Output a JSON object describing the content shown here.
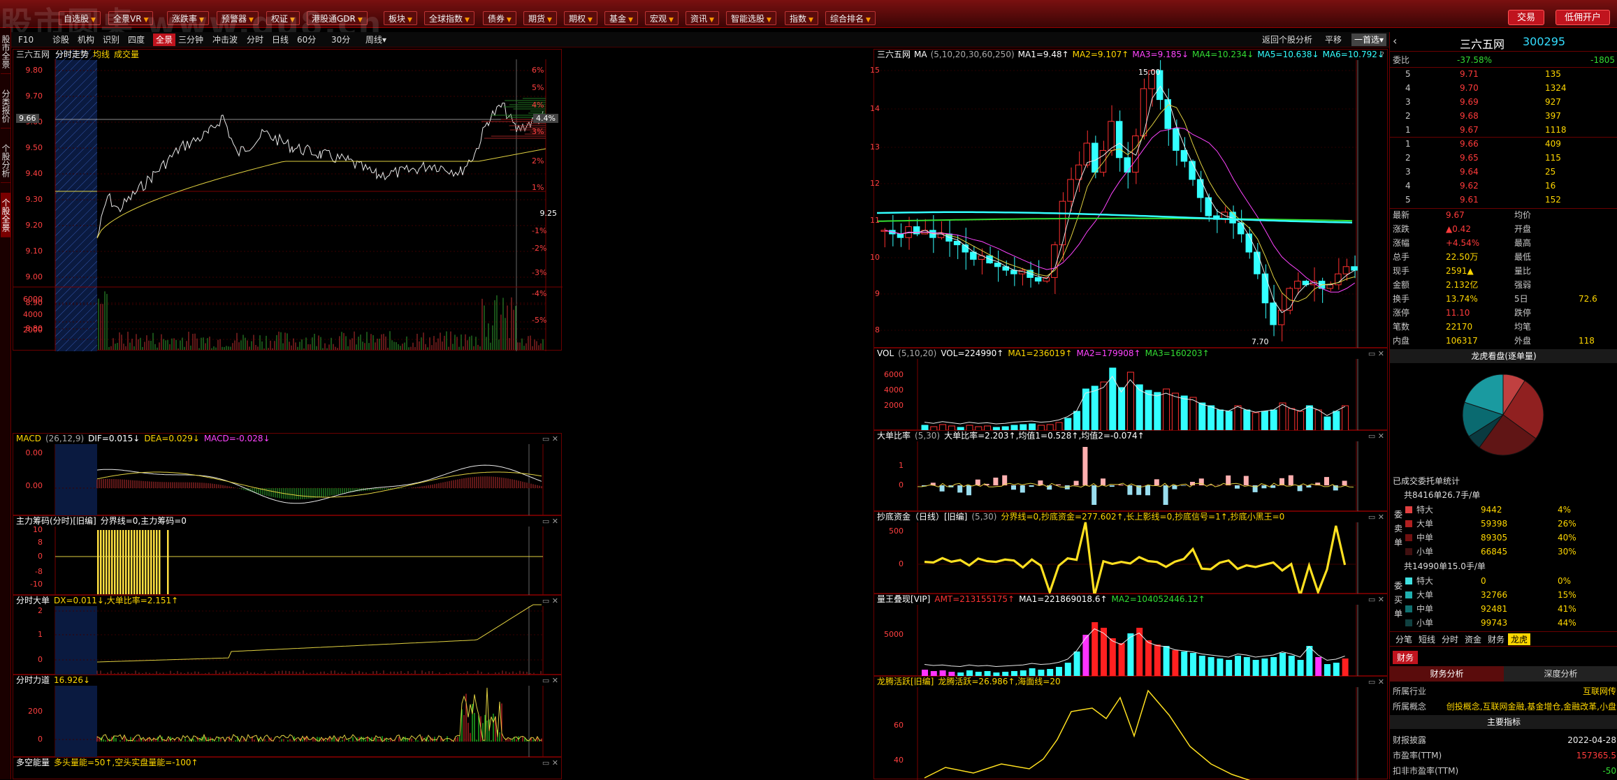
{
  "watermark": "股市圆桌 www.gu8.cn",
  "topbar": {
    "buttons": [
      "自选股",
      "全景VR",
      "涨跌率",
      "预警器",
      "权证",
      "港股通GDR",
      "板块",
      "全球指数",
      "债券",
      "期货",
      "期权",
      "基金",
      "宏观",
      "资讯",
      "智能选股",
      "指数",
      "综合排名"
    ],
    "trade": "交易",
    "open_account": "低佣开户"
  },
  "left_tabs": [
    "股市全景",
    "分类报价",
    "个股分析",
    "个股全景"
  ],
  "subbar": {
    "items": [
      "F10",
      "诊股",
      "机构",
      "识别",
      "四度",
      "全景",
      "三分钟",
      "冲击波",
      "分时",
      "日线",
      "60分",
      "30分",
      "周线▾"
    ],
    "active": "全景",
    "right_items": [
      "返回个股分析",
      "平移",
      "一首选▾"
    ]
  },
  "intraday": {
    "title": "三六五网",
    "tabs": [
      "分时走势",
      "均线",
      "成交量"
    ],
    "yleft": [
      "9.80",
      "9.70",
      "9.60",
      "9.50",
      "9.40",
      "9.30",
      "9.20",
      "9.10",
      "9.00",
      "8.90",
      "8.80"
    ],
    "yright": [
      "6%",
      "5%",
      "4%",
      "3%",
      "2%",
      "1%",
      "-1%",
      "-2%",
      "-3%",
      "-4%",
      "-5%"
    ],
    "price_tag": "9.66",
    "pct_tag": "4.4%",
    "mid_label": "9.25",
    "vol_axis": [
      "6000",
      "4000",
      "2000"
    ]
  },
  "macd": {
    "name": "MACD",
    "params": "(26,12,9)",
    "dif": "DIF=0.015↓",
    "dea": "DEA=0.029↓",
    "macd": "MACD=-0.028↓",
    "axis": [
      "0.00",
      "0.00"
    ]
  },
  "zljm": {
    "name": "主力筹码(分时)[旧编]",
    "text": "分界线=0,主力筹码=0",
    "axis": [
      "10",
      "8",
      "0",
      "-8",
      "-10"
    ]
  },
  "fsdd": {
    "name": "分时大单",
    "text": "DX=0.011↓,大单比率=2.151↑",
    "axis": [
      "2",
      "1",
      "0"
    ]
  },
  "fsld": {
    "name": "分时力道",
    "text": "16.926↓",
    "axis": [
      "200",
      "0"
    ]
  },
  "dknl": {
    "name": "多空能量",
    "text": "多头量能=50↑,空头实盘量能=-100↑"
  },
  "kline": {
    "title": "三六五网",
    "ma_label": "MA",
    "ma_params": "(5,10,20,30,60,250)",
    "ma1": "MA1=9.48↑",
    "ma2": "MA2=9.107↑",
    "ma3": "MA3=9.185↓",
    "ma4": "MA4=10.234↓",
    "ma5": "MA5=10.638↓",
    "ma6": "MA6=10.792↓",
    "yaxis": [
      "15",
      "14",
      "13",
      "12",
      "11",
      "10",
      "9",
      "8"
    ],
    "high_label": "15.00",
    "low_label": "7.70"
  },
  "vol": {
    "name": "VOL",
    "params": "(5,10,20)",
    "v": "VOL=224990↑",
    "ma1": "MA1=236019↑",
    "ma2": "MA2=179908↑",
    "ma3": "MA3=160203↑",
    "axis": [
      "6000",
      "4000",
      "2000"
    ]
  },
  "ddbl": {
    "name": "大单比率",
    "params": "(5,30)",
    "text": "大单比率=2.203↑,均值1=0.528↑,均值2=-0.074↑",
    "axis": [
      "1",
      "0"
    ]
  },
  "cdzj": {
    "name": "抄底资金（日线）[旧编]",
    "params": "(5,30)",
    "text": "分界线=0,抄底资金=277.602↑,长上影线=0,抄底信号=1↑,抄底小黑王=0",
    "axis": [
      "500",
      "0"
    ]
  },
  "lwjx": {
    "name": "量王叠现[VIP]",
    "amt": "AMT=213155175↑",
    "ma1": "MA1=221869018.6↑",
    "ma2": "MA2=104052446.12↑",
    "axis": [
      "5000"
    ]
  },
  "lthy": {
    "name": "龙腾活跃[旧编]",
    "text": "龙腾活跃=26.986↑,海面线=20",
    "axis": [
      "60",
      "40"
    ]
  },
  "quote": {
    "name": "三六五网",
    "code": "300295",
    "weibi_label": "委比",
    "weibi": "-37.58%",
    "weicha": "-1805",
    "sell": [
      [
        "5",
        "9.71",
        "135"
      ],
      [
        "4",
        "9.70",
        "1324"
      ],
      [
        "3",
        "9.69",
        "927"
      ],
      [
        "2",
        "9.68",
        "397"
      ],
      [
        "1",
        "9.67",
        "1118"
      ]
    ],
    "buy": [
      [
        "1",
        "9.66",
        "409"
      ],
      [
        "2",
        "9.65",
        "115"
      ],
      [
        "3",
        "9.64",
        "25"
      ],
      [
        "4",
        "9.62",
        "16"
      ],
      [
        "5",
        "9.61",
        "152"
      ]
    ],
    "stats": [
      [
        "最新",
        "9.67",
        "均价",
        ""
      ],
      [
        "涨跌",
        "▲0.42",
        "开盘",
        ""
      ],
      [
        "涨幅",
        "+4.54%",
        "最高",
        ""
      ],
      [
        "总手",
        "22.50万",
        "最低",
        ""
      ],
      [
        "现手",
        "2591▲",
        "量比",
        ""
      ],
      [
        "金额",
        "2.132亿",
        "强弱",
        ""
      ],
      [
        "换手",
        "13.74%",
        "5日",
        "72.6"
      ],
      [
        "涨停",
        "11.10",
        "跌停",
        ""
      ],
      [
        "笔数",
        "22170",
        "均笔",
        ""
      ],
      [
        "内盘",
        "106317",
        "外盘",
        "118"
      ]
    ],
    "lhk_title": "龙虎看盘(逐单量)",
    "pie": [
      {
        "v": 0.09,
        "c": "#c04040"
      },
      {
        "v": 0.26,
        "c": "#902020"
      },
      {
        "v": 0.25,
        "c": "#601515"
      },
      {
        "v": 0.06,
        "c": "#0a3a40"
      },
      {
        "v": 0.14,
        "c": "#0a6a70"
      },
      {
        "v": 0.2,
        "c": "#1a9aa0"
      }
    ],
    "commit_title": "已成交委托单统计",
    "sell_total": "共8416单26.7手/单",
    "sell_side": [
      "委",
      "卖",
      "单"
    ],
    "sell_rows": [
      [
        "特大",
        "9442",
        "4%"
      ],
      [
        "大单",
        "59398",
        "26%"
      ],
      [
        "中单",
        "89305",
        "40%"
      ],
      [
        "小单",
        "66845",
        "30%"
      ]
    ],
    "buy_total": "共14990单15.0手/单",
    "buy_side": [
      "委",
      "买",
      "单"
    ],
    "buy_rows": [
      [
        "特大",
        "0",
        "0%"
      ],
      [
        "大单",
        "32766",
        "15%"
      ],
      [
        "中单",
        "92481",
        "41%"
      ],
      [
        "小单",
        "99743",
        "44%"
      ]
    ],
    "tabs": [
      "分笔",
      "短线",
      "分时",
      "资金",
      "财务",
      "龙虎"
    ],
    "fin_tab": "财务",
    "fin_sub": [
      "财务分析",
      "深度分析"
    ],
    "industry_label": "所属行业",
    "industry": "互联网传",
    "concept_label": "所属概念",
    "concept": "创投概念,互联网金融,基金增仓,金融改革,小盘",
    "main_title": "主要指标",
    "report_label": "财报披露",
    "report": "2022-04-28",
    "pe_label": "市盈率(TTM)",
    "pe": "157365.5",
    "pe2_label": "扣非市盈率(TTM)",
    "pe2": "-50"
  }
}
